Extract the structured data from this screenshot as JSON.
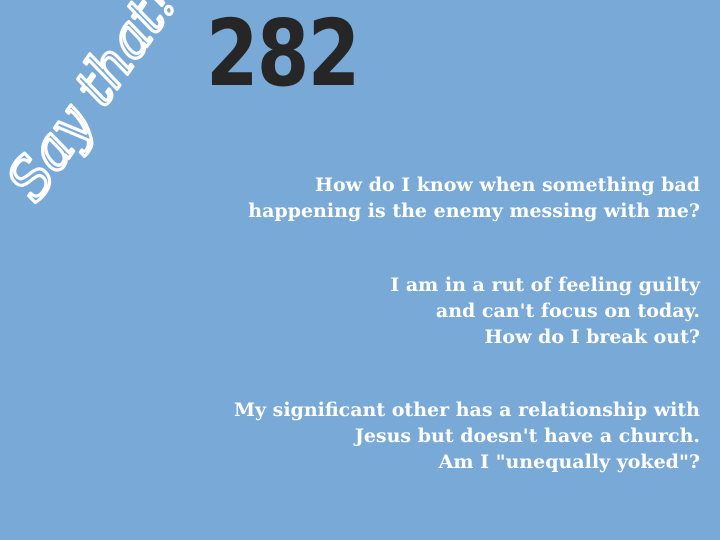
{
  "logo": {
    "text": "Say that!",
    "color": "#ffffff"
  },
  "episode": {
    "number": "282",
    "color": "#262626"
  },
  "questions": [
    {
      "lines": [
        "How do I know when something bad",
        "happening is the enemy messing with me?"
      ]
    },
    {
      "lines": [
        "I am in a rut of feeling guilty",
        "and can't focus on today.",
        "How do I break out?"
      ]
    },
    {
      "lines": [
        "My significant other has a relationship with",
        "Jesus but doesn't have a church.",
        "Am I \"unequally yoked\"?"
      ]
    }
  ],
  "colors": {
    "background": "#79a9d6",
    "text": "#ffffff"
  }
}
